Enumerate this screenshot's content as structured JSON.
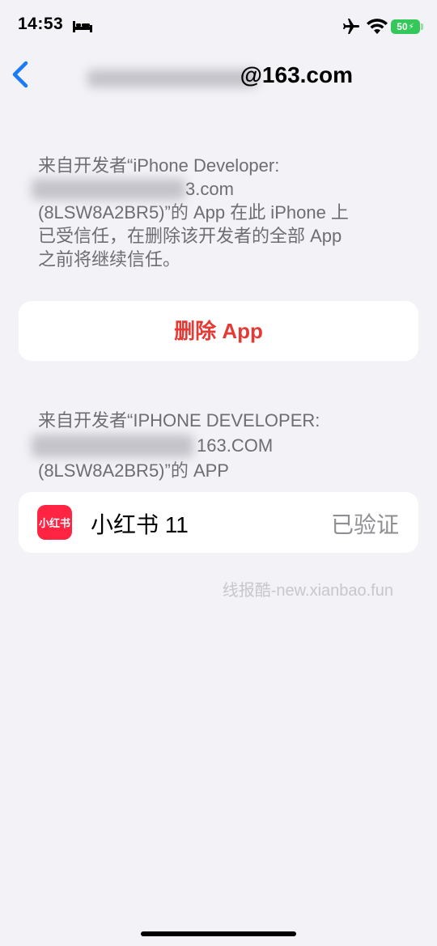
{
  "status_bar": {
    "time": "14:53",
    "battery": "50",
    "icons": [
      "bed-icon",
      "airplane-icon",
      "wifi-icon",
      "battery-icon"
    ]
  },
  "nav": {
    "title_visible": "@163.com",
    "back_icon": "chevron-left-icon",
    "accent": "#1a7cf5"
  },
  "trust_section": {
    "line1": "来自开发者“iPhone Developer:",
    "line2": "3.com",
    "line3": "(8LSW8A2BR5)”的 App 在此 iPhone 上",
    "line4": "已受信任，在删除该开发者的全部 App",
    "line5": "之前将继续信任。"
  },
  "delete_button": {
    "label": "删除 App",
    "color": "#e53935"
  },
  "apps_section": {
    "line1": "来自开发者“IPHONE DEVELOPER:",
    "line2": "163.COM",
    "line3": "(8LSW8A2BR5)”的 APP"
  },
  "app_row": {
    "icon_text": "小红书",
    "name": "小红书 11",
    "status": "已验证",
    "icon_color": "#ff2442"
  },
  "watermark": "线报酷-new.xianbao.fun"
}
